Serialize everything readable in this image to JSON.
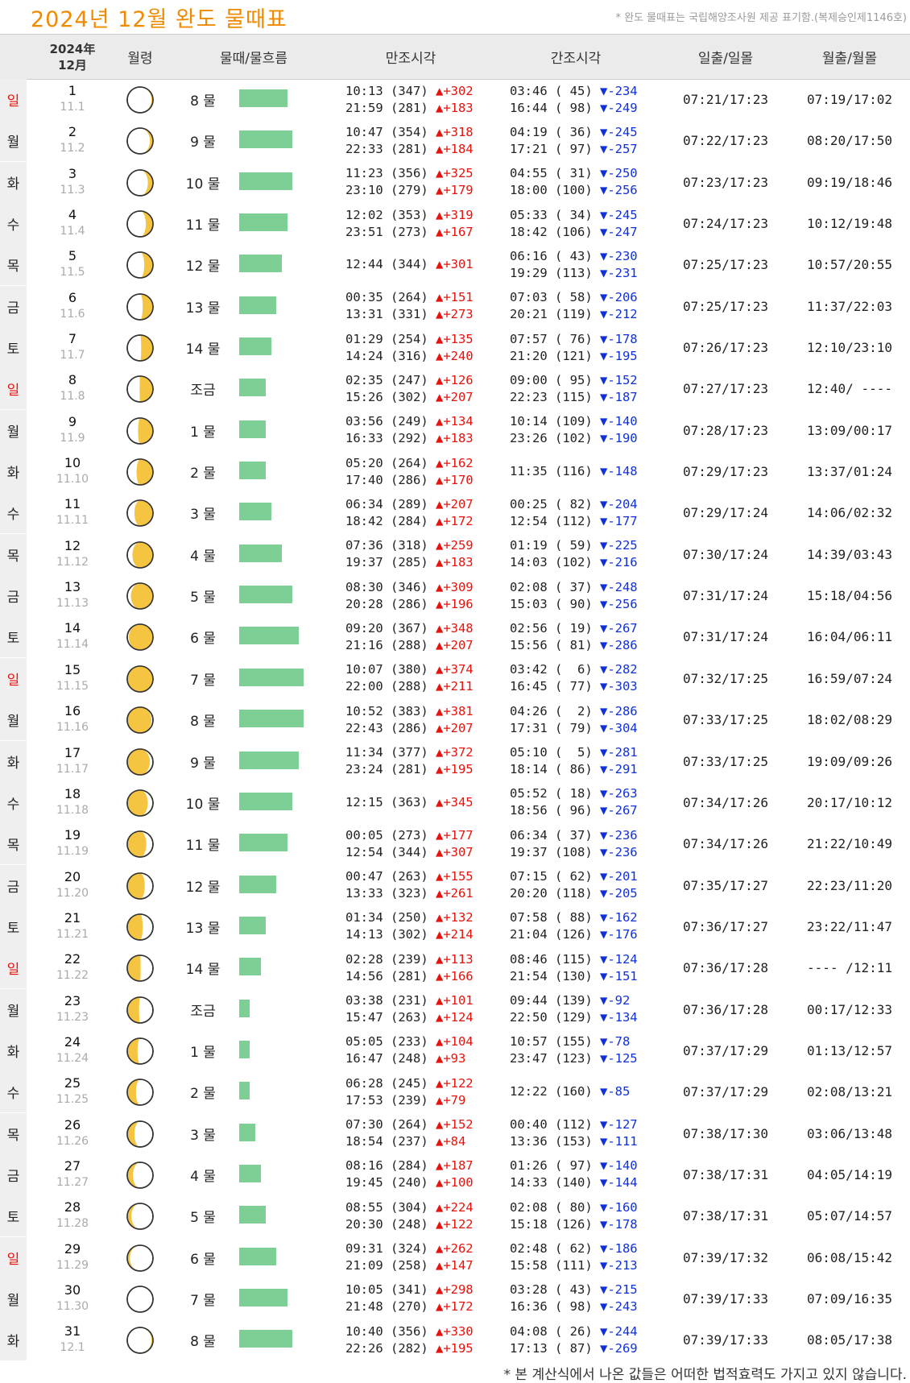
{
  "title": "2024년 12월 완도 물때표",
  "notice": "* 완도 물때표는 국립해양조사원 제공 표기함.(복제승인제1146호)",
  "headers": {
    "date_year": "2024年",
    "date_month": "12月",
    "moon_phase": "월령",
    "tide_flow": "물때/물흐름",
    "high_tide": "만조시각",
    "low_tide": "간조시각",
    "sun": "일출/일몰",
    "moon": "월출/월몰"
  },
  "colors": {
    "title": "#f08a00",
    "sunday": "#e8120c",
    "rise": "#e8120c",
    "fall": "#1030d8",
    "bar": "#7ecf95",
    "moon_lit": "#f5c542"
  },
  "rows": [
    {
      "day": "일",
      "sun_day": true,
      "d": "1",
      "lunar": "11.1",
      "mul": "8 물",
      "bar": 0.65,
      "hi": [
        "10:13 (347) ",
        "21:59 (281) "
      ],
      "hid": [
        "▲+302",
        "▲+183"
      ],
      "lo": [
        "03:46 ( 45) ",
        "16:44 ( 98) "
      ],
      "lod": [
        "▼-234",
        "▼-249"
      ],
      "sun": "07:21/17:23",
      "moon": "07:19/17:02",
      "phase": 0.03
    },
    {
      "day": "월",
      "sun_day": false,
      "d": "2",
      "lunar": "11.2",
      "mul": "9 물",
      "bar": 0.72,
      "hi": [
        "10:47 (354) ",
        "22:33 (281) "
      ],
      "hid": [
        "▲+318",
        "▲+184"
      ],
      "lo": [
        "04:19 ( 36) ",
        "17:21 ( 97) "
      ],
      "lod": [
        "▼-245",
        "▼-257"
      ],
      "sun": "07:22/17:23",
      "moon": "08:20/17:50",
      "phase": 0.06
    },
    {
      "day": "화",
      "sun_day": false,
      "d": "3",
      "lunar": "11.3",
      "mul": "10 물",
      "bar": 0.72,
      "hi": [
        "11:23 (356) ",
        "23:10 (279) "
      ],
      "hid": [
        "▲+325",
        "▲+179"
      ],
      "lo": [
        "04:55 ( 31) ",
        "18:00 (100) "
      ],
      "lod": [
        "▼-250",
        "▼-256"
      ],
      "sun": "07:23/17:23",
      "moon": "09:19/18:46",
      "phase": 0.1
    },
    {
      "day": "수",
      "sun_day": false,
      "d": "4",
      "lunar": "11.4",
      "mul": "11 물",
      "bar": 0.65,
      "hi": [
        "12:02 (353) ",
        "23:51 (273) "
      ],
      "hid": [
        "▲+319",
        "▲+167"
      ],
      "lo": [
        "05:33 ( 34) ",
        "18:42 (106) "
      ],
      "lod": [
        "▼-245",
        "▼-247"
      ],
      "sun": "07:24/17:23",
      "moon": "10:12/19:48",
      "phase": 0.14
    },
    {
      "day": "목",
      "sun_day": false,
      "d": "5",
      "lunar": "11.5",
      "mul": "12 물",
      "bar": 0.58,
      "hi": [
        "12:44 (344) "
      ],
      "hid": [
        "▲+301"
      ],
      "lo": [
        "06:16 ( 43) ",
        "19:29 (113) "
      ],
      "lod": [
        "▼-230",
        "▼-231"
      ],
      "sun": "07:25/17:23",
      "moon": "10:57/20:55",
      "phase": 0.17
    },
    {
      "day": "금",
      "sun_day": false,
      "d": "6",
      "lunar": "11.6",
      "mul": "13 물",
      "bar": 0.5,
      "hi": [
        "00:35 (264) ",
        "13:31 (331) "
      ],
      "hid": [
        "▲+151",
        "▲+273"
      ],
      "lo": [
        "07:03 ( 58) ",
        "20:21 (119) "
      ],
      "lod": [
        "▼-206",
        "▼-212"
      ],
      "sun": "07:25/17:23",
      "moon": "11:37/22:03",
      "phase": 0.2
    },
    {
      "day": "토",
      "sun_day": false,
      "d": "7",
      "lunar": "11.7",
      "mul": "14 물",
      "bar": 0.43,
      "hi": [
        "01:29 (254) ",
        "14:24 (316) "
      ],
      "hid": [
        "▲+135",
        "▲+240"
      ],
      "lo": [
        "07:57 ( 76) ",
        "21:20 (121) "
      ],
      "lod": [
        "▼-178",
        "▼-195"
      ],
      "sun": "07:26/17:23",
      "moon": "12:10/23:10",
      "phase": 0.23
    },
    {
      "day": "일",
      "sun_day": true,
      "d": "8",
      "lunar": "11.8",
      "mul": "조금",
      "bar": 0.36,
      "hi": [
        "02:35 (247) ",
        "15:26 (302) "
      ],
      "hid": [
        "▲+126",
        "▲+207"
      ],
      "lo": [
        "09:00 ( 95) ",
        "22:23 (115) "
      ],
      "lod": [
        "▼-152",
        "▼-187"
      ],
      "sun": "07:27/17:23",
      "moon": "12:40/ ----",
      "phase": 0.26
    },
    {
      "day": "월",
      "sun_day": false,
      "d": "9",
      "lunar": "11.9",
      "mul": "1 물",
      "bar": 0.36,
      "hi": [
        "03:56 (249) ",
        "16:33 (292) "
      ],
      "hid": [
        "▲+134",
        "▲+183"
      ],
      "lo": [
        "10:14 (109) ",
        "23:26 (102) "
      ],
      "lod": [
        "▼-140",
        "▼-190"
      ],
      "sun": "07:28/17:23",
      "moon": "13:09/00:17",
      "phase": 0.29
    },
    {
      "day": "화",
      "sun_day": false,
      "d": "10",
      "lunar": "11.10",
      "mul": "2 물",
      "bar": 0.36,
      "hi": [
        "05:20 (264) ",
        "17:40 (286) "
      ],
      "hid": [
        "▲+162",
        "▲+170"
      ],
      "lo": [
        "11:35 (116) "
      ],
      "lod": [
        "▼-148"
      ],
      "sun": "07:29/17:23",
      "moon": "13:37/01:24",
      "phase": 0.32
    },
    {
      "day": "수",
      "sun_day": false,
      "d": "11",
      "lunar": "11.11",
      "mul": "3 물",
      "bar": 0.43,
      "hi": [
        "06:34 (289) ",
        "18:42 (284) "
      ],
      "hid": [
        "▲+207",
        "▲+172"
      ],
      "lo": [
        "00:25 ( 82) ",
        "12:54 (112) "
      ],
      "lod": [
        "▼-204",
        "▼-177"
      ],
      "sun": "07:29/17:24",
      "moon": "14:06/02:32",
      "phase": 0.36
    },
    {
      "day": "목",
      "sun_day": false,
      "d": "12",
      "lunar": "11.12",
      "mul": "4 물",
      "bar": 0.58,
      "hi": [
        "07:36 (318) ",
        "19:37 (285) "
      ],
      "hid": [
        "▲+259",
        "▲+183"
      ],
      "lo": [
        "01:19 ( 59) ",
        "14:03 (102) "
      ],
      "lod": [
        "▼-225",
        "▼-216"
      ],
      "sun": "07:30/17:24",
      "moon": "14:39/03:43",
      "phase": 0.4
    },
    {
      "day": "금",
      "sun_day": false,
      "d": "13",
      "lunar": "11.13",
      "mul": "5 물",
      "bar": 0.72,
      "hi": [
        "08:30 (346) ",
        "20:28 (286) "
      ],
      "hid": [
        "▲+309",
        "▲+196"
      ],
      "lo": [
        "02:08 ( 37) ",
        "15:03 ( 90) "
      ],
      "lod": [
        "▼-248",
        "▼-256"
      ],
      "sun": "07:31/17:24",
      "moon": "15:18/04:56",
      "phase": 0.43
    },
    {
      "day": "토",
      "sun_day": false,
      "d": "14",
      "lunar": "11.14",
      "mul": "6 물",
      "bar": 0.8,
      "hi": [
        "09:20 (367) ",
        "21:16 (288) "
      ],
      "hid": [
        "▲+348",
        "▲+207"
      ],
      "lo": [
        "02:56 ( 19) ",
        "15:56 ( 81) "
      ],
      "lod": [
        "▼-267",
        "▼-286"
      ],
      "sun": "07:31/17:24",
      "moon": "16:04/06:11",
      "phase": 0.47
    },
    {
      "day": "일",
      "sun_day": true,
      "d": "15",
      "lunar": "11.15",
      "mul": "7 물",
      "bar": 0.87,
      "hi": [
        "10:07 (380) ",
        "22:00 (288) "
      ],
      "hid": [
        "▲+374",
        "▲+211"
      ],
      "lo": [
        "03:42 (  6) ",
        "16:45 ( 77) "
      ],
      "lod": [
        "▼-282",
        "▼-303"
      ],
      "sun": "07:32/17:25",
      "moon": "16:59/07:24",
      "phase": 0.5
    },
    {
      "day": "월",
      "sun_day": false,
      "d": "16",
      "lunar": "11.16",
      "mul": "8 물",
      "bar": 0.87,
      "hi": [
        "10:52 (383) ",
        "22:43 (286) "
      ],
      "hid": [
        "▲+381",
        "▲+207"
      ],
      "lo": [
        "04:26 (  2) ",
        "17:31 ( 79) "
      ],
      "lod": [
        "▼-286",
        "▼-304"
      ],
      "sun": "07:33/17:25",
      "moon": "18:02/08:29",
      "phase": 0.53
    },
    {
      "day": "화",
      "sun_day": false,
      "d": "17",
      "lunar": "11.17",
      "mul": "9 물",
      "bar": 0.8,
      "hi": [
        "11:34 (377) ",
        "23:24 (281) "
      ],
      "hid": [
        "▲+372",
        "▲+195"
      ],
      "lo": [
        "05:10 (  5) ",
        "18:14 ( 86) "
      ],
      "lod": [
        "▼-281",
        "▼-291"
      ],
      "sun": "07:33/17:25",
      "moon": "19:09/09:26",
      "phase": 0.56
    },
    {
      "day": "수",
      "sun_day": false,
      "d": "18",
      "lunar": "11.18",
      "mul": "10 물",
      "bar": 0.72,
      "hi": [
        "12:15 (363) "
      ],
      "hid": [
        "▲+345"
      ],
      "lo": [
        "05:52 ( 18) ",
        "18:56 ( 96) "
      ],
      "lod": [
        "▼-263",
        "▼-267"
      ],
      "sun": "07:34/17:26",
      "moon": "20:17/10:12",
      "phase": 0.6
    },
    {
      "day": "목",
      "sun_day": false,
      "d": "19",
      "lunar": "11.19",
      "mul": "11 물",
      "bar": 0.65,
      "hi": [
        "00:05 (273) ",
        "12:54 (344) "
      ],
      "hid": [
        "▲+177",
        "▲+307"
      ],
      "lo": [
        "06:34 ( 37) ",
        "19:37 (108) "
      ],
      "lod": [
        "▼-236",
        "▼-236"
      ],
      "sun": "07:34/17:26",
      "moon": "21:22/10:49",
      "phase": 0.63
    },
    {
      "day": "금",
      "sun_day": false,
      "d": "20",
      "lunar": "11.20",
      "mul": "12 물",
      "bar": 0.5,
      "hi": [
        "00:47 (263) ",
        "13:33 (323) "
      ],
      "hid": [
        "▲+155",
        "▲+261"
      ],
      "lo": [
        "07:15 ( 62) ",
        "20:20 (118) "
      ],
      "lod": [
        "▼-201",
        "▼-205"
      ],
      "sun": "07:35/17:27",
      "moon": "22:23/11:20",
      "phase": 0.66
    },
    {
      "day": "토",
      "sun_day": false,
      "d": "21",
      "lunar": "11.21",
      "mul": "13 물",
      "bar": 0.36,
      "hi": [
        "01:34 (250) ",
        "14:13 (302) "
      ],
      "hid": [
        "▲+132",
        "▲+214"
      ],
      "lo": [
        "07:58 ( 88) ",
        "21:04 (126) "
      ],
      "lod": [
        "▼-162",
        "▼-176"
      ],
      "sun": "07:36/17:27",
      "moon": "23:22/11:47",
      "phase": 0.7
    },
    {
      "day": "일",
      "sun_day": true,
      "d": "22",
      "lunar": "11.22",
      "mul": "14 물",
      "bar": 0.29,
      "hi": [
        "02:28 (239) ",
        "14:56 (281) "
      ],
      "hid": [
        "▲+113",
        "▲+166"
      ],
      "lo": [
        "08:46 (115) ",
        "21:54 (130) "
      ],
      "lod": [
        "▼-124",
        "▼-151"
      ],
      "sun": "07:36/17:28",
      "moon": "---- /12:11",
      "phase": 0.74
    },
    {
      "day": "월",
      "sun_day": false,
      "d": "23",
      "lunar": "11.23",
      "mul": "조금",
      "bar": 0.14,
      "hi": [
        "03:38 (231) ",
        "15:47 (263) "
      ],
      "hid": [
        "▲+101",
        "▲+124"
      ],
      "lo": [
        "09:44 (139) ",
        "22:50 (129) "
      ],
      "lod": [
        "▼-92",
        "▼-134"
      ],
      "sun": "07:36/17:28",
      "moon": "00:17/12:33",
      "phase": 0.77
    },
    {
      "day": "화",
      "sun_day": false,
      "d": "24",
      "lunar": "11.24",
      "mul": "1 물",
      "bar": 0.14,
      "hi": [
        "05:05 (233) ",
        "16:47 (248) "
      ],
      "hid": [
        "▲+104",
        "▲+93"
      ],
      "lo": [
        "10:57 (155) ",
        "23:47 (123) "
      ],
      "lod": [
        "▼-78",
        "▼-125"
      ],
      "sun": "07:37/17:29",
      "moon": "01:13/12:57",
      "phase": 0.8
    },
    {
      "day": "수",
      "sun_day": false,
      "d": "25",
      "lunar": "11.25",
      "mul": "2 물",
      "bar": 0.14,
      "hi": [
        "06:28 (245) ",
        "17:53 (239) "
      ],
      "hid": [
        "▲+122",
        "▲+79"
      ],
      "lo": [
        "12:22 (160) "
      ],
      "lod": [
        "▼-85"
      ],
      "sun": "07:37/17:29",
      "moon": "02:08/13:21",
      "phase": 0.83
    },
    {
      "day": "목",
      "sun_day": false,
      "d": "26",
      "lunar": "11.26",
      "mul": "3 물",
      "bar": 0.22,
      "hi": [
        "07:30 (264) ",
        "18:54 (237) "
      ],
      "hid": [
        "▲+152",
        "▲+84"
      ],
      "lo": [
        "00:40 (112) ",
        "13:36 (153) "
      ],
      "lod": [
        "▼-127",
        "▼-111"
      ],
      "sun": "07:38/17:30",
      "moon": "03:06/13:48",
      "phase": 0.86
    },
    {
      "day": "금",
      "sun_day": false,
      "d": "27",
      "lunar": "11.27",
      "mul": "4 물",
      "bar": 0.29,
      "hi": [
        "08:16 (284) ",
        "19:45 (240) "
      ],
      "hid": [
        "▲+187",
        "▲+100"
      ],
      "lo": [
        "01:26 ( 97) ",
        "14:33 (140) "
      ],
      "lod": [
        "▼-140",
        "▼-144"
      ],
      "sun": "07:38/17:31",
      "moon": "04:05/14:19",
      "phase": 0.89
    },
    {
      "day": "토",
      "sun_day": false,
      "d": "28",
      "lunar": "11.28",
      "mul": "5 물",
      "bar": 0.36,
      "hi": [
        "08:55 (304) ",
        "20:30 (248) "
      ],
      "hid": [
        "▲+224",
        "▲+122"
      ],
      "lo": [
        "02:08 ( 80) ",
        "15:18 (126) "
      ],
      "lod": [
        "▼-160",
        "▼-178"
      ],
      "sun": "07:38/17:31",
      "moon": "05:07/14:57",
      "phase": 0.92
    },
    {
      "day": "일",
      "sun_day": true,
      "d": "29",
      "lunar": "11.29",
      "mul": "6 물",
      "bar": 0.5,
      "hi": [
        "09:31 (324) ",
        "21:09 (258) "
      ],
      "hid": [
        "▲+262",
        "▲+147"
      ],
      "lo": [
        "02:48 ( 62) ",
        "15:58 (111) "
      ],
      "lod": [
        "▼-186",
        "▼-213"
      ],
      "sun": "07:39/17:32",
      "moon": "06:08/15:42",
      "phase": 0.95
    },
    {
      "day": "월",
      "sun_day": false,
      "d": "30",
      "lunar": "11.30",
      "mul": "7 물",
      "bar": 0.65,
      "hi": [
        "10:05 (341) ",
        "21:48 (270) "
      ],
      "hid": [
        "▲+298",
        "▲+172"
      ],
      "lo": [
        "03:28 ( 43) ",
        "16:36 ( 98) "
      ],
      "lod": [
        "▼-215",
        "▼-243"
      ],
      "sun": "07:39/17:33",
      "moon": "07:09/16:35",
      "phase": 0.99
    },
    {
      "day": "화",
      "sun_day": false,
      "d": "31",
      "lunar": "12.1",
      "mul": "8 물",
      "bar": 0.72,
      "hi": [
        "10:40 (356) ",
        "22:26 (282) "
      ],
      "hid": [
        "▲+330",
        "▲+195"
      ],
      "lo": [
        "04:08 ( 26) ",
        "17:13 ( 87) "
      ],
      "lod": [
        "▼-244",
        "▼-269"
      ],
      "sun": "07:39/17:33",
      "moon": "08:05/17:38",
      "phase": 0.03
    }
  ],
  "footnote": "* 본 계산식에서 나온 값들은 어떠한 법적효력도 가지고 있지 않습니다."
}
